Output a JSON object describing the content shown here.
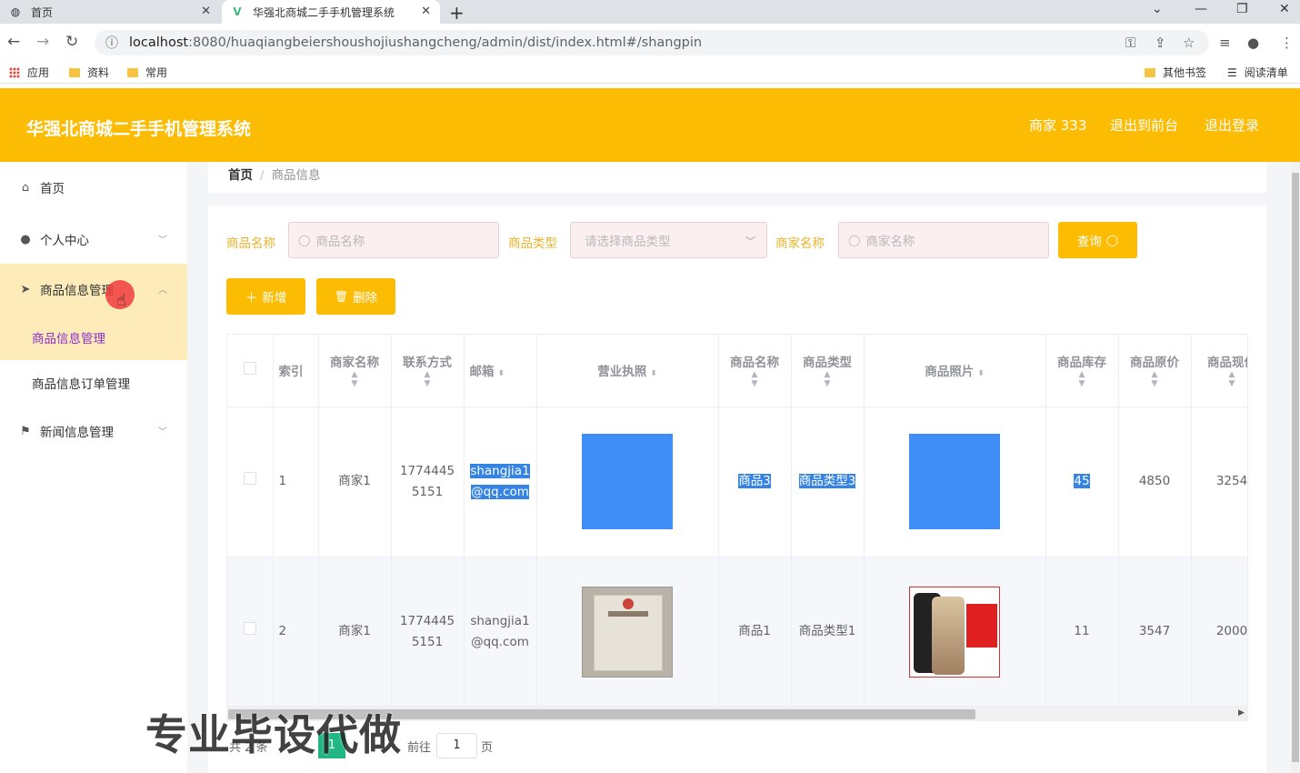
{
  "browser": {
    "tabs": [
      {
        "label": "首页",
        "active": false
      },
      {
        "label": "华强北商城二手手机管理系统",
        "active": true
      }
    ],
    "url_host": "localhost",
    "url_path": ":8080/huaqiangbeiershoushojiushangcheng/admin/dist/index.html#/shangpin",
    "bookmarks": [
      "应用",
      "资料",
      "常用"
    ],
    "bookmarks_right": [
      "其他书签",
      "阅读清单"
    ]
  },
  "header": {
    "title": "华强北商城二手手机管理系统",
    "user": "商家 333",
    "to_front": "退出到前台",
    "logout": "退出登录"
  },
  "sidebar": {
    "home": "首页",
    "personal": "个人中心",
    "goods_mgmt": "商品信息管理",
    "sub_goods": "商品信息管理",
    "sub_orders": "商品信息订单管理",
    "news_mgmt": "新闻信息管理"
  },
  "breadcrumb": {
    "home": "首页",
    "sep": "/",
    "current": "商品信息"
  },
  "filters": {
    "name_label": "商品名称",
    "name_placeholder": "商品名称",
    "type_label": "商品类型",
    "type_placeholder": "请选择商品类型",
    "merchant_label": "商家名称",
    "merchant_placeholder": "商家名称",
    "search_btn": "查询"
  },
  "actions": {
    "add": "新增",
    "delete": "删除"
  },
  "table": {
    "headers": [
      "索引",
      "商家名称",
      "联系方式",
      "邮箱",
      "营业执照",
      "商品名称",
      "商品类型",
      "商品照片",
      "商品库存",
      "商品原价",
      "商品现价"
    ],
    "rows": [
      {
        "index": "1",
        "merchant": "商家1",
        "phone": "17744455151",
        "email": "shangjia1@qq.com",
        "name": "商品3",
        "type": "商品类型3",
        "stock": "45",
        "orig": "4850",
        "now": "3254"
      },
      {
        "index": "2",
        "merchant": "商家1",
        "phone": "17744455151",
        "email": "shangjia1@qq.com",
        "name": "商品1",
        "type": "商品类型1",
        "stock": "11",
        "orig": "3547",
        "now": "2000"
      }
    ]
  },
  "pager": {
    "total": "共 2 条",
    "current_page": "1",
    "goto": "前往",
    "goto_value": "1",
    "page_unit": "页"
  },
  "watermark": "专业毕设代做",
  "colors": {
    "accent": "#fcbc04",
    "selection": "#3584e4",
    "pager_active": "#20b785"
  }
}
